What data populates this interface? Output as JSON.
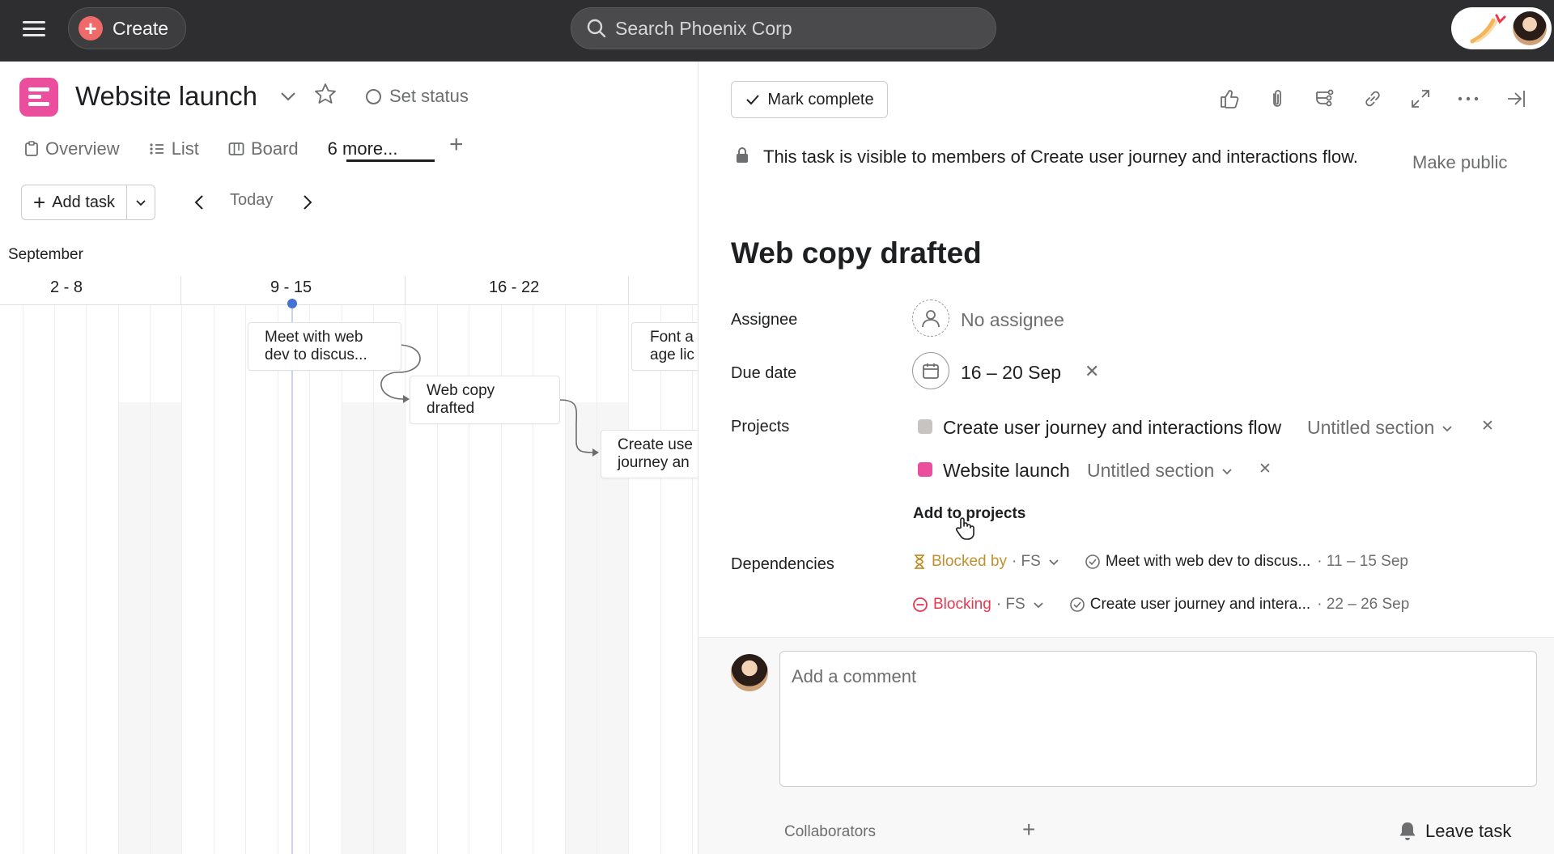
{
  "topbar": {
    "create_label": "Create",
    "search_placeholder": "Search Phoenix Corp"
  },
  "project": {
    "title": "Website launch",
    "set_status": "Set status",
    "tabs": [
      {
        "label": "Overview",
        "icon": "overview-icon"
      },
      {
        "label": "List",
        "icon": "list-icon"
      },
      {
        "label": "Board",
        "icon": "board-icon"
      },
      {
        "label": "6 more...",
        "icon": ""
      }
    ],
    "add_task": "Add task",
    "today": "Today",
    "month": "September",
    "weeks": [
      "2 - 8",
      "9 - 15",
      "16 - 22"
    ],
    "timeline_tasks": [
      {
        "line1": "Meet with web",
        "line2": "dev to discus..."
      },
      {
        "line1": "Web copy",
        "line2": "drafted"
      },
      {
        "line1": "Create use",
        "line2": "journey an"
      },
      {
        "line1": "Font a",
        "line2": "age lic"
      }
    ],
    "brand_color": "#ea4e9d"
  },
  "task": {
    "mark_complete": "Mark complete",
    "privacy_text": "This task is visible to members of Create user journey and interactions flow.",
    "make_public": "Make public",
    "title": "Web copy drafted",
    "labels": {
      "assignee": "Assignee",
      "due_date": "Due date",
      "projects": "Projects",
      "dependencies": "Dependencies"
    },
    "assignee": "No assignee",
    "due_date": "16 – 20 Sep",
    "projects": [
      {
        "name": "Create user journey and interactions flow",
        "section": "Untitled section",
        "color": "#c7c4c4"
      },
      {
        "name": "Website launch",
        "section": "Untitled section",
        "color": "#ea4e9d"
      }
    ],
    "add_to_projects": "Add to projects",
    "dependencies": [
      {
        "type": "Blocked by",
        "fs": "· FS",
        "task": "Meet with web dev to discus...",
        "date": "· 11 – 15 Sep",
        "color": "#c28f2c"
      },
      {
        "type": "Blocking",
        "fs": "· FS",
        "task": "Create user journey and intera...",
        "date": "· 22 – 26 Sep",
        "color": "#e8384f"
      }
    ],
    "comment_placeholder": "Add a comment",
    "collaborators_label": "Collaborators",
    "leave_task": "Leave task"
  }
}
